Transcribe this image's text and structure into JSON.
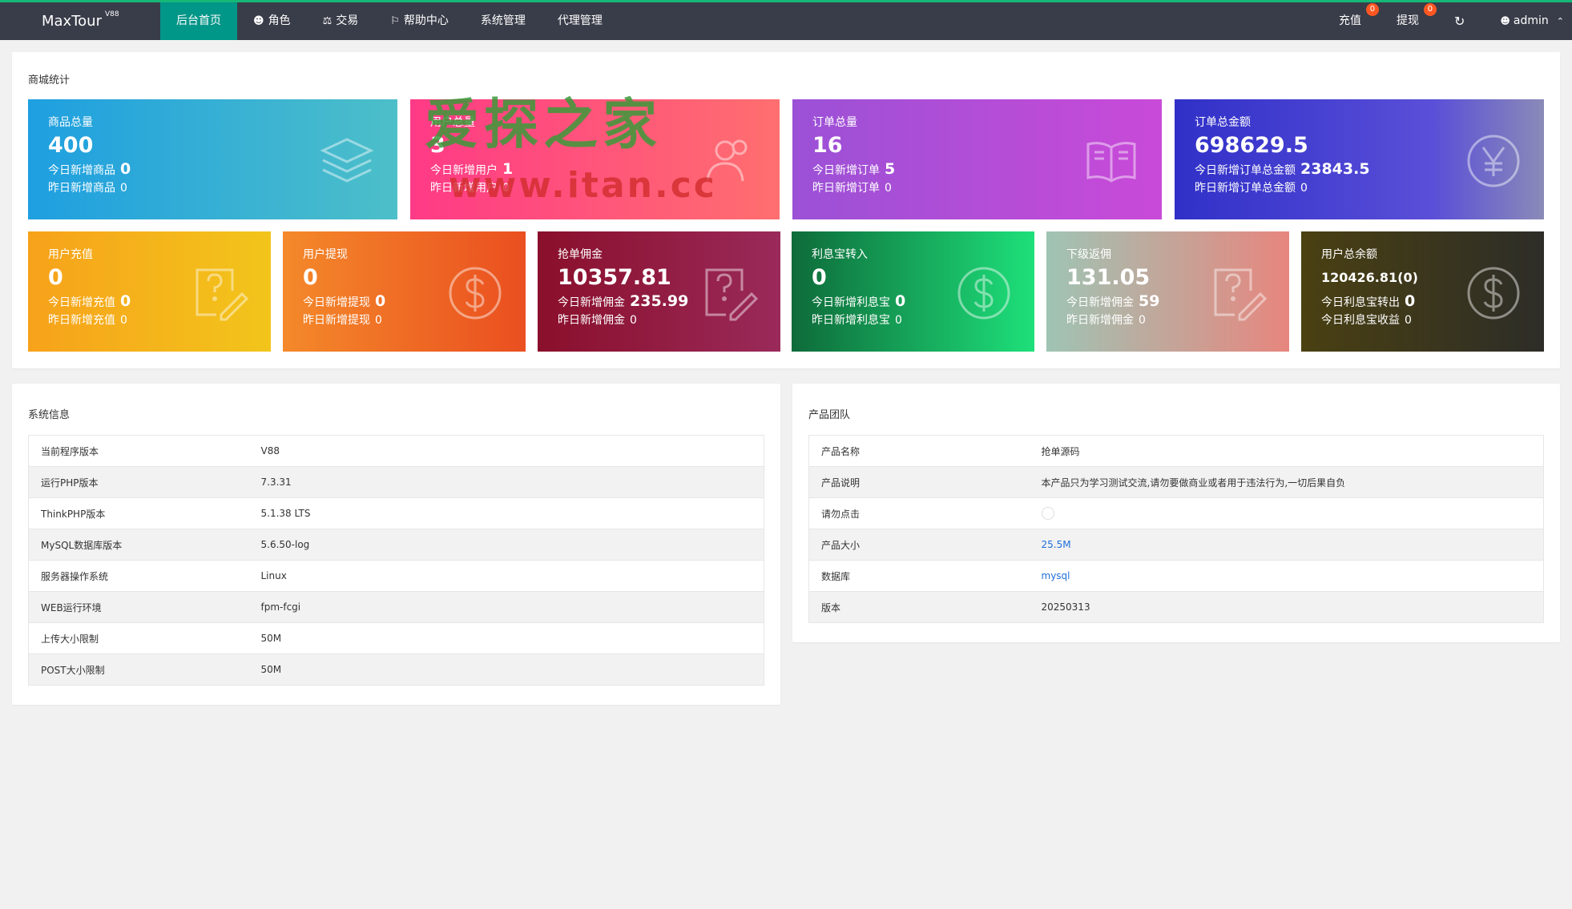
{
  "header": {
    "logo": "MaxTour",
    "logo_version": "V88",
    "nav": [
      {
        "label": "后台首页",
        "icon": "",
        "active": true
      },
      {
        "label": "角色",
        "icon": "user-icon"
      },
      {
        "label": "交易",
        "icon": "scale-icon"
      },
      {
        "label": "帮助中心",
        "icon": "flag-icon"
      },
      {
        "label": "系统管理",
        "icon": ""
      },
      {
        "label": "代理管理",
        "icon": ""
      }
    ],
    "recharge_label": "充值",
    "recharge_badge": "0",
    "withdraw_label": "提现",
    "withdraw_badge": "0",
    "user": "admin"
  },
  "stats": {
    "title": "商城统计",
    "row1": [
      {
        "label": "商品总量",
        "value": "400",
        "l1": "今日新增商品",
        "v1": "0",
        "l2": "昨日新增商品",
        "v2": "0",
        "icon": "layers-icon"
      },
      {
        "label": "用户总量",
        "value": "3",
        "l1": "今日新增用户",
        "v1": "1",
        "l2": "昨日新增用户",
        "v2": "0",
        "icon": "users-icon"
      },
      {
        "label": "订单总量",
        "value": "16",
        "l1": "今日新增订单",
        "v1": "5",
        "l2": "昨日新增订单",
        "v2": "0",
        "icon": "book-icon"
      },
      {
        "label": "订单总金额",
        "value": "698629.5",
        "l1": "今日新增订单总金额",
        "v1": "23843.5",
        "l2": "昨日新增订单总金额",
        "v2": "0",
        "icon": "yen-icon"
      }
    ],
    "row2": [
      {
        "label": "用户充值",
        "value": "0",
        "l1": "今日新增充值",
        "v1": "0",
        "l2": "昨日新增充值",
        "v2": "0",
        "icon": "question-doc-icon"
      },
      {
        "label": "用户提现",
        "value": "0",
        "l1": "今日新增提现",
        "v1": "0",
        "l2": "昨日新增提现",
        "v2": "0",
        "icon": "dollar-icon"
      },
      {
        "label": "抢单佣金",
        "value": "10357.81",
        "l1": "今日新增佣金",
        "v1": "235.99",
        "l2": "昨日新增佣金",
        "v2": "0",
        "icon": "question-doc-icon"
      },
      {
        "label": "利息宝转入",
        "value": "0",
        "l1": "今日新增利息宝",
        "v1": "0",
        "l2": "昨日新增利息宝",
        "v2": "0",
        "icon": "dollar-icon"
      },
      {
        "label": "下级返佣",
        "value": "131.05",
        "l1": "今日新增佣金",
        "v1": "59",
        "l2": "昨日新增佣金",
        "v2": "0",
        "icon": "question-doc-icon"
      },
      {
        "label": "用户总余额",
        "value": "120426.81(0)",
        "l1": "今日利息宝转出",
        "v1": "0",
        "l2": "今日利息宝收益",
        "v2": "0",
        "icon": "dollar-icon"
      }
    ]
  },
  "system": {
    "title": "系统信息",
    "rows": [
      {
        "k": "当前程序版本",
        "v": "V88"
      },
      {
        "k": "运行PHP版本",
        "v": "7.3.31"
      },
      {
        "k": "ThinkPHP版本",
        "v": "5.1.38 LTS"
      },
      {
        "k": "MySQL数据库版本",
        "v": "5.6.50-log"
      },
      {
        "k": "服务器操作系统",
        "v": "Linux"
      },
      {
        "k": "WEB运行环境",
        "v": "fpm-fcgi"
      },
      {
        "k": "上传大小限制",
        "v": "50M"
      },
      {
        "k": "POST大小限制",
        "v": "50M"
      }
    ]
  },
  "team": {
    "title": "产品团队",
    "rows": [
      {
        "k": "产品名称",
        "v": "抢单源码"
      },
      {
        "k": "产品说明",
        "v": "本产品只为学习测试交流,请勿要做商业或者用于违法行为,一切后果自负"
      },
      {
        "k": "请勿点击",
        "v": ""
      },
      {
        "k": "产品大小",
        "v": "25.5M"
      },
      {
        "k": "数据库",
        "v": "mysql"
      },
      {
        "k": "版本",
        "v": "20250313"
      }
    ]
  },
  "watermark": {
    "line1": "爱探之家",
    "line2": "www.itan.cc"
  },
  "colors": {
    "topbar": "#393d49",
    "accent": "#009688",
    "badge": "#ff5722",
    "link": "#1e6fd9"
  }
}
